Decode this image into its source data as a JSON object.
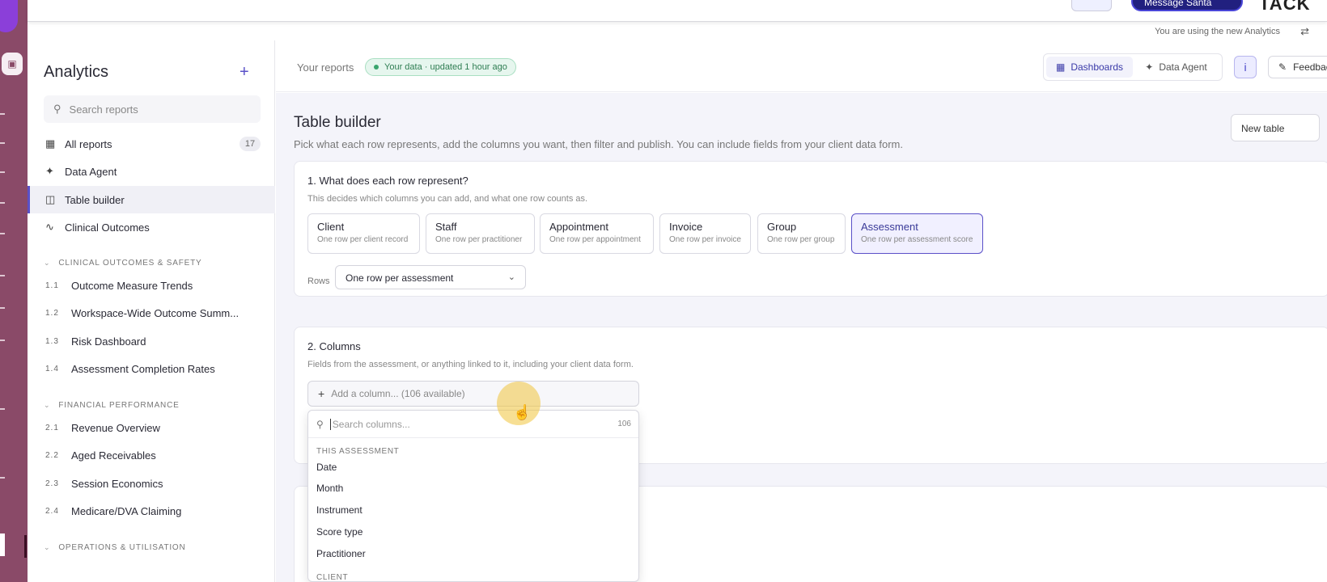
{
  "topbar": {
    "brand": "TACK",
    "action_pill": "Message Santa",
    "notice": "You are using the new Analytics"
  },
  "sidebar": {
    "title": "Analytics",
    "search_placeholder": "Search reports",
    "items": [
      {
        "label": "All reports",
        "icon": "grid-icon",
        "count": "17"
      },
      {
        "label": "Data Agent",
        "icon": "sparkle-icon"
      },
      {
        "label": "Table builder",
        "icon": "table-icon",
        "active": true
      },
      {
        "label": "Clinical Outcomes",
        "icon": "pulse-icon"
      }
    ],
    "sections": [
      {
        "title": "CLINICAL OUTCOMES & SAFETY",
        "items": [
          {
            "num": "1.1",
            "label": "Outcome Measure Trends"
          },
          {
            "num": "1.2",
            "label": "Workspace-Wide Outcome Summ..."
          },
          {
            "num": "1.3",
            "label": "Risk Dashboard"
          },
          {
            "num": "1.4",
            "label": "Assessment Completion Rates"
          }
        ]
      },
      {
        "title": "FINANCIAL PERFORMANCE",
        "items": [
          {
            "num": "2.1",
            "label": "Revenue Overview"
          },
          {
            "num": "2.2",
            "label": "Aged Receivables"
          },
          {
            "num": "2.3",
            "label": "Session Economics"
          },
          {
            "num": "2.4",
            "label": "Medicare/DVA Claiming"
          }
        ]
      },
      {
        "title": "OPERATIONS & UTILISATION",
        "items": []
      }
    ]
  },
  "header": {
    "label": "Your reports",
    "badge": "Your data · updated 1 hour ago",
    "tabs": [
      {
        "label": "Dashboards",
        "icon": "grid-icon",
        "active": true
      },
      {
        "label": "Data Agent",
        "icon": "sparkle-icon"
      }
    ],
    "feedback": "Feedback"
  },
  "main": {
    "title": "Table builder",
    "subtitle": "Pick what each row represents, add the columns you want, then filter and publish. You can include fields from your client data form.",
    "new_table": "New table",
    "step1": {
      "title": "1. What does each row represent?",
      "subtitle": "This decides which columns you can add, and what one row counts as.",
      "options": [
        {
          "title": "Client",
          "desc": "One row per client record"
        },
        {
          "title": "Staff",
          "desc": "One row per practitioner"
        },
        {
          "title": "Appointment",
          "desc": "One row per appointment"
        },
        {
          "title": "Invoice",
          "desc": "One row per invoice"
        },
        {
          "title": "Group",
          "desc": "One row per group"
        },
        {
          "title": "Assessment",
          "desc": "One row per assessment score",
          "selected": true
        }
      ],
      "rows_label": "Rows",
      "rows_value": "One row per assessment"
    },
    "step2": {
      "title": "2. Columns",
      "subtitle": "Fields from the assessment, or anything linked to it, including your client data form.",
      "add_column": "Add a column... (106 available)"
    },
    "dropdown": {
      "search_placeholder": "Search columns...",
      "count": "106",
      "groups": [
        {
          "title": "THIS ASSESSMENT",
          "items": [
            "Date",
            "Month",
            "Instrument",
            "Score type",
            "Practitioner"
          ]
        },
        {
          "title": "CLIENT",
          "items": []
        }
      ]
    }
  }
}
